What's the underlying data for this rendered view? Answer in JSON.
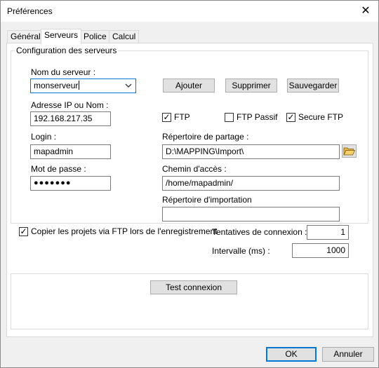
{
  "window": {
    "title": "Préférences",
    "close_glyph": "✕"
  },
  "tabs": [
    {
      "label": "Général"
    },
    {
      "label": "Serveurs",
      "active": true
    },
    {
      "label": "Police"
    },
    {
      "label": "Calcul"
    }
  ],
  "server_config": {
    "legend": "Configuration des serveurs",
    "server_name_label": "Nom du serveur :",
    "server_name_value": "monserveur",
    "add_button": "Ajouter",
    "delete_button": "Supprimer",
    "save_button": "Sauvegarder",
    "address_label": "Adresse IP ou Nom :",
    "address_value": "192.168.217.35",
    "ftp_label": "FTP",
    "ftp_checked": true,
    "ftp_passive_label": "FTP Passif",
    "ftp_passive_checked": false,
    "secure_ftp_label": "Secure FTP",
    "secure_ftp_checked": true,
    "login_label": "Login :",
    "login_value": "mapadmin",
    "share_dir_label": "Répertoire de partage :",
    "share_dir_value": "D:\\MAPPING\\Import\\",
    "password_label": "Mot de passe :",
    "password_value": "●●●●●●●",
    "path_label": "Chemin d'accès :",
    "path_value": "/home/mapadmin/",
    "import_dir_label": "Répertoire d'importation",
    "import_dir_value": ""
  },
  "copy_projects": {
    "label": "Copier les projets via FTP lors de l'enregistrement",
    "checked": true
  },
  "retries": {
    "label": "Tentatives de connexion :",
    "value": "1"
  },
  "interval": {
    "label": "Intervalle (ms) :",
    "value": "1000"
  },
  "test_connection_button": "Test connexion",
  "footer": {
    "ok": "OK",
    "cancel": "Annuler"
  },
  "icons": {
    "close": "close-icon",
    "dropdown": "chevron-down-icon",
    "folder": "folder-open-icon",
    "check": "checkmark-icon"
  }
}
